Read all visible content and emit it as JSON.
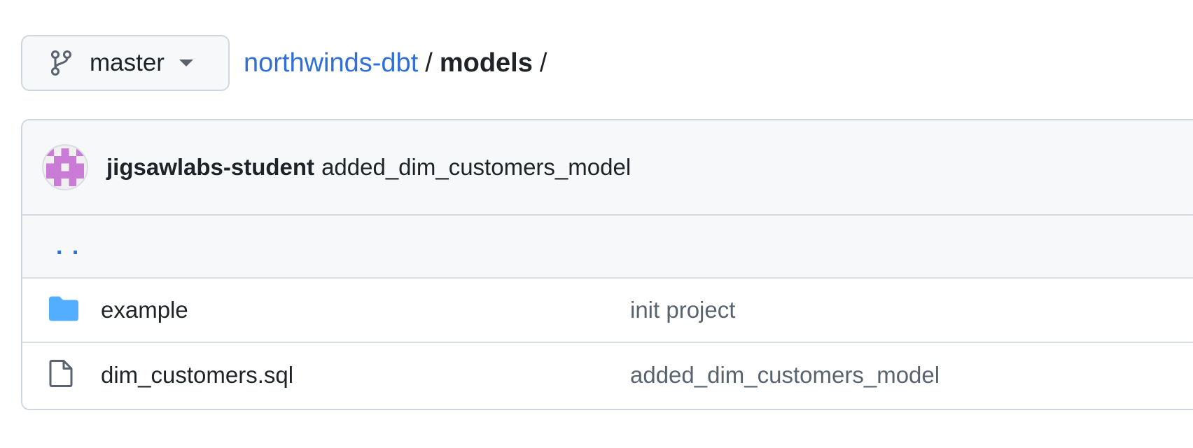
{
  "branch": {
    "name": "master",
    "icon": "git-branch-icon",
    "caret_icon": "triangle-down-icon"
  },
  "breadcrumb": {
    "repo": "northwinds-dbt",
    "separator": "/",
    "current": "models",
    "trailing_separator": "/"
  },
  "latest_commit": {
    "author": "jigsawlabs-student",
    "message": "added_dim_customers_model",
    "avatar_icon": "identicon-avatar"
  },
  "parent_dir": {
    "label": ". ."
  },
  "files": [
    {
      "name": "example",
      "type": "directory",
      "icon": "folder-icon",
      "commit_message": "init project"
    },
    {
      "name": "dim_customers.sql",
      "type": "file",
      "icon": "file-icon",
      "commit_message": "added_dim_customers_model"
    }
  ],
  "colors": {
    "link": "#2f6fd6",
    "folder": "#54aeff",
    "border": "#d0d7de",
    "header_bg": "#f6f8fa",
    "avatar": "#c97bd6",
    "muted_text": "#59636e"
  }
}
